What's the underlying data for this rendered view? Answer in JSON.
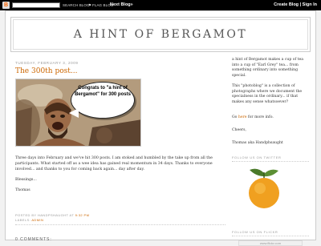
{
  "navbar": {
    "search_button": "SEARCH BLOG",
    "flag_button": "FLAG BLOG",
    "next_blog": "Next Blog»",
    "create_blog": "Create Blog",
    "sign_in": "Sign In",
    "separator": "|"
  },
  "blog": {
    "title": "A HINT OF BERGAMOT"
  },
  "post": {
    "date": "TUESDAY, FEBRUARY 3, 2009",
    "title": "The 300th post...",
    "image_caption": "Congrats to \"a hint of Bergamot\" for 300 posts",
    "paragraph1": "Three days into February and we've hit 300 posts. I am stoked and humbled by the take up from all the participants. What started off as a wee idea has gained real momentum in 34 days. Thanks to everyone involved... and thanks to you for coming back again... day after day.",
    "paragraph2": "Blessings...",
    "paragraph3": "Thomas",
    "posted_by_label": "POSTED BY",
    "author": "HANDPSHAUGHT",
    "at_label": "AT",
    "time": "9:32 PM",
    "labels_label": "LABELS:",
    "label": "ADMIN",
    "comments": "0 COMMENTS:"
  },
  "sidebar": {
    "about1": "a hint of Bergamot makes a cup of tea into a cup of \"Earl Grey\" tea... from something ordinary into something special.",
    "about2": "This \"photoblog\" is a collection of photographs where we document the specialness in the ordinary... if that makes any sense whatsoever?",
    "go_prefix": "Go",
    "go_link": "here",
    "go_suffix": "for more info.",
    "cheers": "Cheers,",
    "signature": "Thomas aka Handphsaught",
    "twitter_head": "FOLLOW US ON TWITTER",
    "flickr_head": "FOLLOW US ON FLICKR",
    "flickr_badge": "www.flickr.com"
  }
}
